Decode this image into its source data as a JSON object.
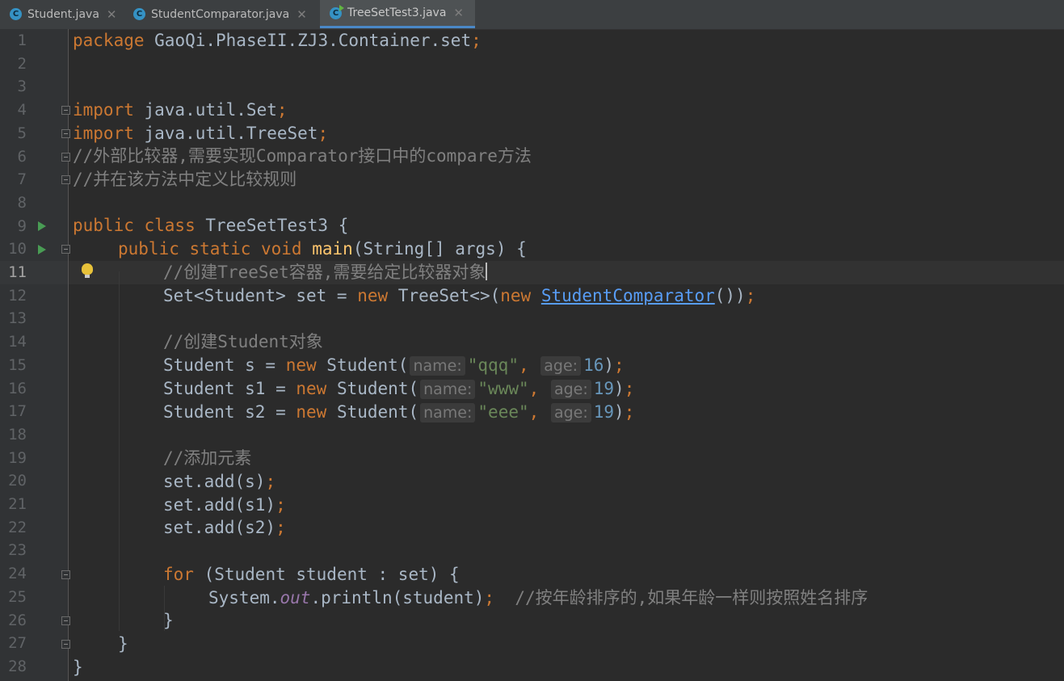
{
  "tabs": [
    {
      "icon": "C",
      "label": "Student.java"
    },
    {
      "icon": "C",
      "label": "StudentComparator.java"
    },
    {
      "icon": "C",
      "label": "TreeSetTest3.java"
    }
  ],
  "line_numbers": [
    "1",
    "2",
    "3",
    "4",
    "5",
    "6",
    "7",
    "8",
    "9",
    "10",
    "11",
    "12",
    "13",
    "14",
    "15",
    "16",
    "17",
    "18",
    "19",
    "20",
    "21",
    "22",
    "23",
    "24",
    "25",
    "26",
    "27",
    "28"
  ],
  "code": {
    "l1": {
      "kw": "package",
      "rest": " GaoQi.PhaseII.ZJ3.Container.set",
      "semi": ";"
    },
    "l4": {
      "kw": "import",
      "rest": " java.util.Set",
      "semi": ";"
    },
    "l5": {
      "kw": "import",
      "rest": " java.util.TreeSet",
      "semi": ";"
    },
    "l6": "//外部比较器,需要实现Comparator接口中的compare方法",
    "l7": "//并在该方法中定义比较规则",
    "l9": {
      "kw": "public class",
      "rest": " TreeSetTest3 {"
    },
    "l10": {
      "kw": "public static void",
      "method": "main",
      "rest": "(String[] args) {"
    },
    "l11": "//创建TreeSet容器,需要给定比较器对象",
    "l12": {
      "pre": "Set<Student> set = ",
      "kw": "new",
      "mid": " TreeSet<>(",
      "kw2": "new",
      "link": "StudentComparator",
      "post": "())",
      "semi": ";"
    },
    "l14": "//创建Student对象",
    "l15": {
      "pre": "Student s = ",
      "kw": "new",
      "cls": " Student(",
      "hint1": "name:",
      "str": "\"qqq\"",
      "comma": ",",
      "hint2": "age:",
      "num": "16",
      "close": ")",
      "semi": ";"
    },
    "l16": {
      "pre": "Student s1 = ",
      "kw": "new",
      "cls": " Student(",
      "hint1": "name:",
      "str": "\"www\"",
      "comma": ",",
      "hint2": "age:",
      "num": "19",
      "close": ")",
      "semi": ";"
    },
    "l17": {
      "pre": "Student s2 = ",
      "kw": "new",
      "cls": " Student(",
      "hint1": "name:",
      "str": "\"eee\"",
      "comma": ",",
      "hint2": "age:",
      "num": "19",
      "close": ")",
      "semi": ";"
    },
    "l19": "//添加元素",
    "l20": {
      "text": "set.add(s)",
      "semi": ";"
    },
    "l21": {
      "text": "set.add(s1)",
      "semi": ";"
    },
    "l22": {
      "text": "set.add(s2)",
      "semi": ";"
    },
    "l24": {
      "kw": "for",
      "rest": " (Student student : set) {"
    },
    "l25": {
      "pre": "System.",
      "field": "out",
      "mid": ".println(student)",
      "semi": ";",
      "comment": "//按年龄排序的,如果年龄一样则按照姓名排序"
    },
    "l26": "}",
    "l27": "}",
    "l28": "}"
  },
  "colors": {
    "background": "#2b2b2b",
    "keyword": "#cc7832",
    "comment": "#808080",
    "string": "#6a8759",
    "number": "#6897bb",
    "method": "#ffc66d",
    "link": "#589df6"
  }
}
